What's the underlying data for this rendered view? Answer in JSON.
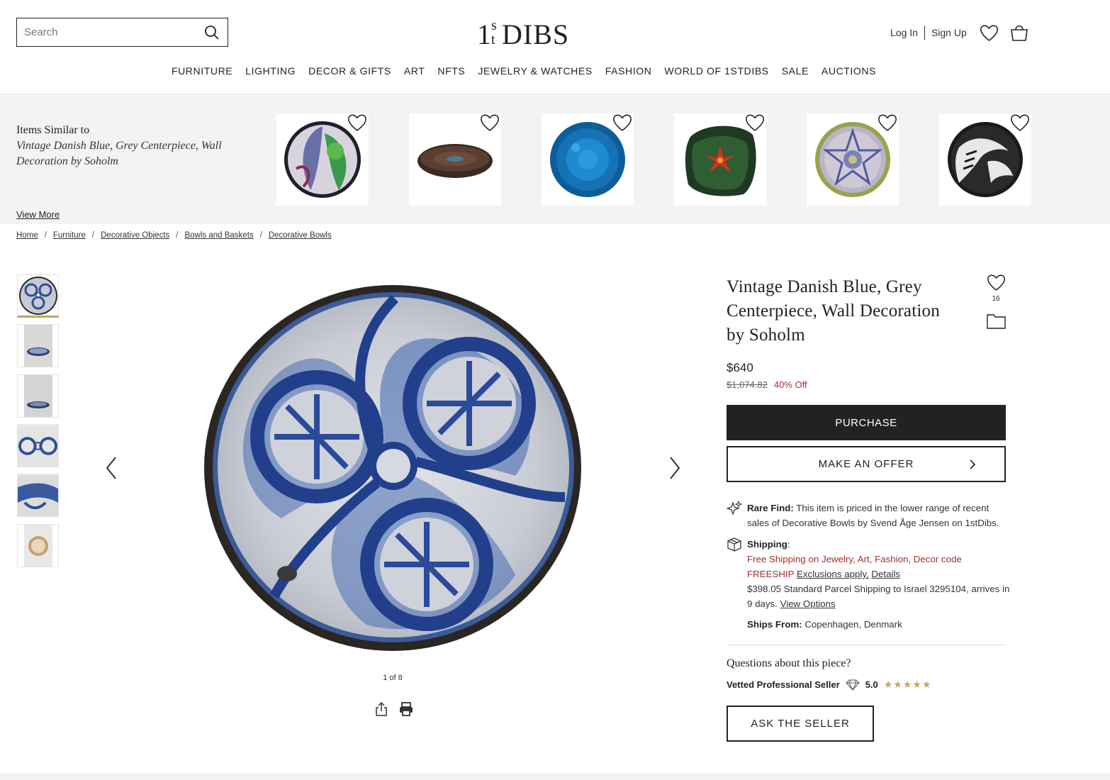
{
  "header": {
    "search_placeholder": "Search",
    "logo_text": "1stDIBS",
    "login": "Log In",
    "signup": "Sign Up"
  },
  "nav": [
    "FURNITURE",
    "LIGHTING",
    "DECOR & GIFTS",
    "ART",
    "NFTS",
    "JEWELRY & WATCHES",
    "FASHION",
    "WORLD OF 1STDIBS",
    "SALE",
    "AUCTIONS"
  ],
  "similar": {
    "heading": "Items Similar to",
    "title": "Vintage Danish Blue, Grey Centerpiece, Wall Decoration by Soholm",
    "view_more": "View More"
  },
  "breadcrumb": [
    "Home",
    "Furniture",
    "Decorative Objects",
    "Bowls and Baskets",
    "Decorative Bowls"
  ],
  "gallery": {
    "counter": "1 of 8",
    "thumbnail_count": 6,
    "active_index": 0
  },
  "product": {
    "title": "Vintage Danish Blue, Grey Centerpiece, Wall Decoration by Soholm",
    "favorites_count": "16",
    "price": "$640",
    "original_price": "$1,074.82",
    "discount": "40% Off",
    "purchase_label": "PURCHASE",
    "offer_label": "MAKE AN OFFER"
  },
  "rare_find": {
    "label": "Rare Find:",
    "text": "This item is priced in the lower range of recent sales of Decorative Bowls by Svend Åge Jensen on 1stDibs."
  },
  "shipping": {
    "label": "Shipping",
    "free_text": "Free Shipping on Jewelry, Art, Fashion, Decor code FREESHIP",
    "exclusions_link": "Exclusions apply.",
    "details_link": "Details",
    "standard_text": "$398.05 Standard Parcel Shipping to Israel 3295104, arrives in 9 days.",
    "view_options": "View Options",
    "ships_from_label": "Ships From:",
    "ships_from": "Copenhagen, Denmark"
  },
  "seller": {
    "questions": "Questions about this piece?",
    "badge": "Vetted Professional Seller",
    "rating": "5.0",
    "stars": "★★★★★",
    "ask_label": "ASK THE SELLER"
  },
  "colors": {
    "accent_gold": "#c2a661",
    "sale_red": "#a3312d",
    "dark": "#222222",
    "strip_bg": "#f3f3f3"
  }
}
